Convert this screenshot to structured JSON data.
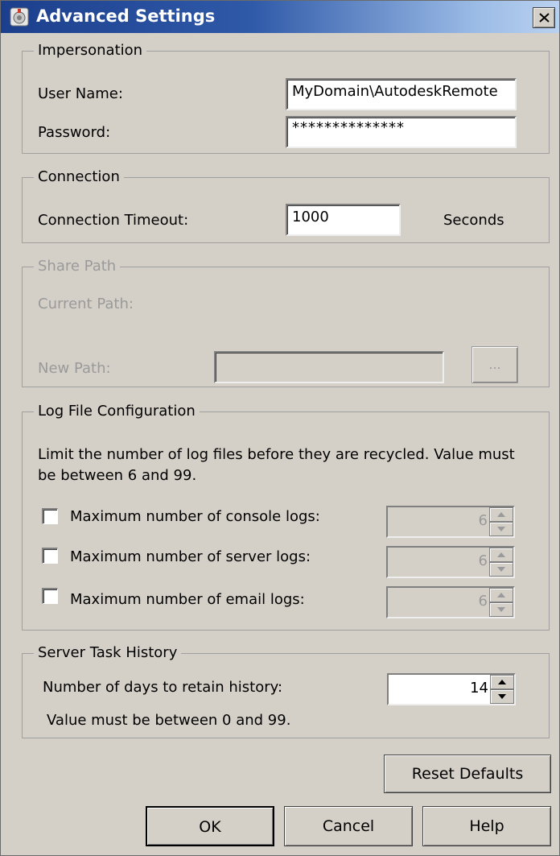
{
  "window": {
    "title": "Advanced Settings",
    "close_glyph": "✕"
  },
  "impersonation": {
    "legend": "Impersonation",
    "user_name_label": "User Name:",
    "user_name_value": "MyDomain\\AutodeskRemote",
    "password_label": "Password:",
    "password_value": "**************"
  },
  "connection": {
    "legend": "Connection",
    "timeout_label": "Connection Timeout:",
    "timeout_value": "1000",
    "unit_label": "Seconds"
  },
  "share_path": {
    "legend": "Share Path",
    "current_path_label": "Current Path:",
    "new_path_label": "New Path:",
    "new_path_value": "",
    "browse_label": "..."
  },
  "log_files": {
    "legend": "Log File Configuration",
    "description": "Limit the number of log files before they are recycled. Value must be between 6 and 99.",
    "items": [
      {
        "label": "Maximum number of console logs:",
        "checked": false,
        "value": "6"
      },
      {
        "label": "Maximum number of server logs:",
        "checked": false,
        "value": "6"
      },
      {
        "label": "Maximum number of email logs:",
        "checked": false,
        "value": "6"
      }
    ]
  },
  "task_history": {
    "legend": "Server Task History",
    "days_label": "Number of days to retain history:",
    "days_value": "14",
    "hint": "Value must be between 0 and 99."
  },
  "buttons": {
    "reset": "Reset Defaults",
    "ok": "OK",
    "cancel": "Cancel",
    "help": "Help"
  },
  "colors": {
    "dialog_bg": "#d4d0c8",
    "title_gradient_start": "#1c3f8d",
    "title_gradient_end": "#b9d1ef",
    "disabled_text": "#9a9a9a"
  }
}
